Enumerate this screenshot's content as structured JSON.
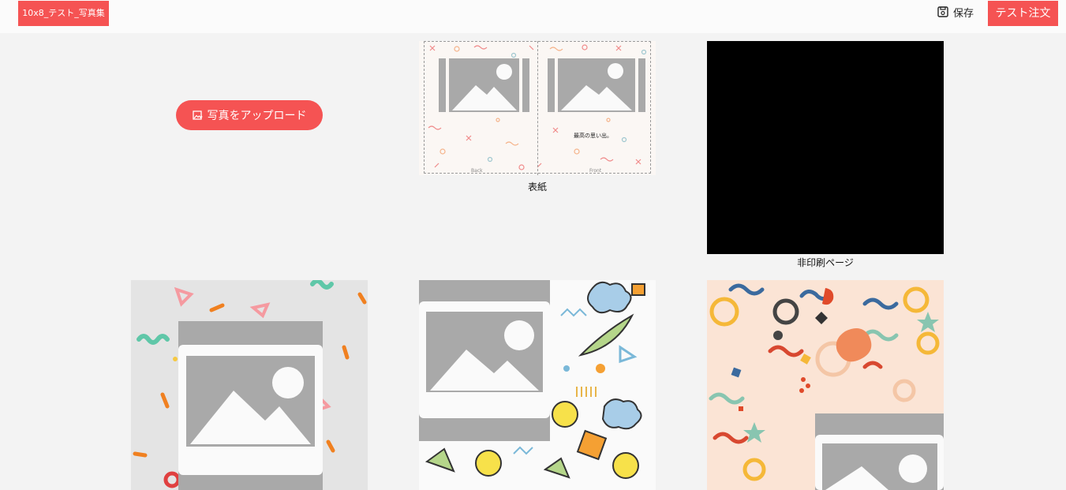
{
  "header": {
    "project_title": "10x8_テスト_写真集",
    "save_label": "保存",
    "order_label": "テスト注文",
    "save_icon": "save-icon"
  },
  "upload": {
    "label": "写真をアップロード",
    "icon": "image-upload-icon"
  },
  "cover": {
    "caption": "表紙",
    "back_label": "Back",
    "front_label": "Front",
    "front_text": "最高の思い出。"
  },
  "non_print": {
    "caption": "非印刷ページ"
  },
  "colors": {
    "accent": "#f55353",
    "placeholder_gray": "#a9a9a9",
    "placeholder_frame": "#fafafa"
  }
}
